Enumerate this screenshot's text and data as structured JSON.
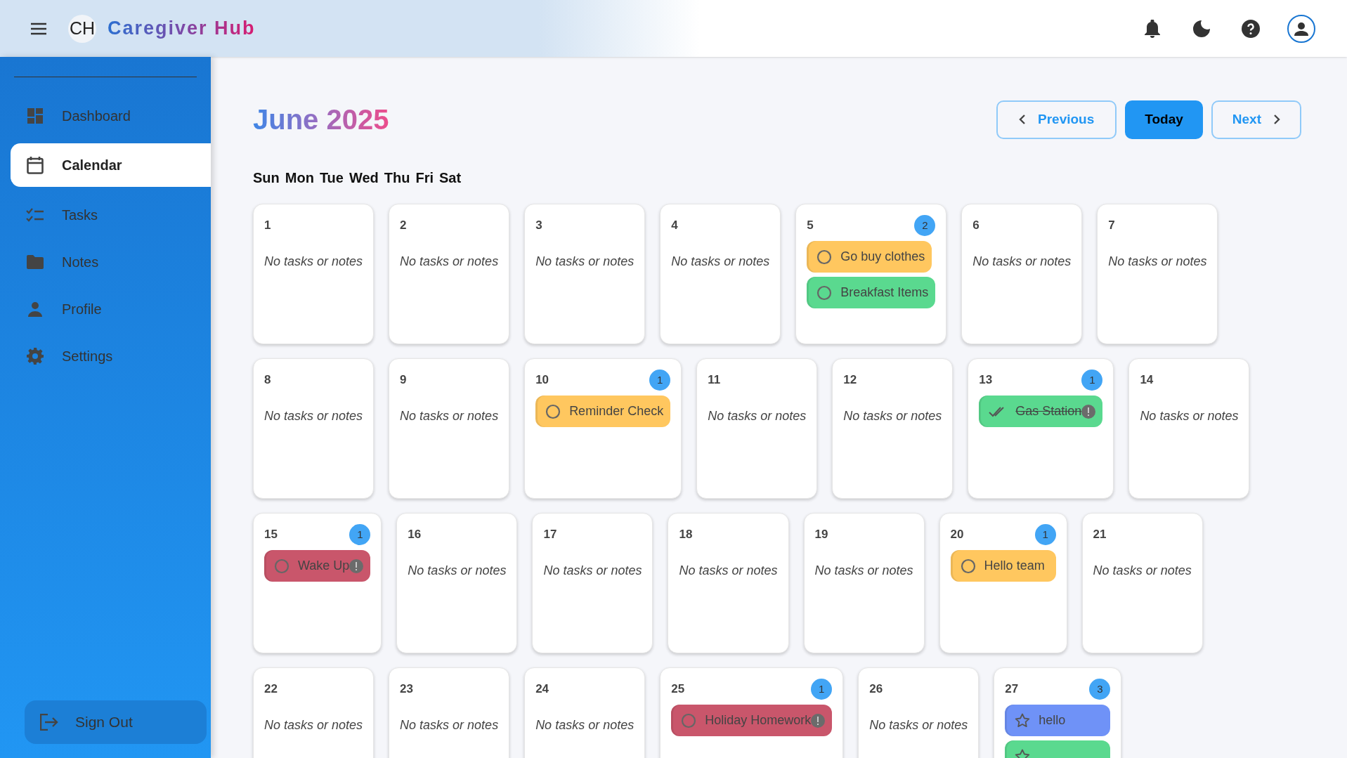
{
  "app": {
    "logo": "CH",
    "title_part1": "Caregiver",
    "title_part2": "Hub"
  },
  "sidebar": {
    "items": [
      {
        "label": "Dashboard",
        "kind": "dashboard",
        "selected": false
      },
      {
        "label": "Calendar",
        "kind": "calendar",
        "selected": true
      },
      {
        "label": "Tasks",
        "kind": "tasks",
        "selected": false
      },
      {
        "label": "Notes",
        "kind": "notes",
        "selected": false
      },
      {
        "label": "Profile",
        "kind": "profile",
        "selected": false
      },
      {
        "label": "Settings",
        "kind": "settings",
        "selected": false
      }
    ],
    "sign_out": "Sign Out"
  },
  "calendar": {
    "month": "June",
    "year": "2025",
    "buttons": {
      "previous": "Previous",
      "today": "Today",
      "next": "Next"
    },
    "weekdays": [
      "Sun",
      "Mon",
      "Tue",
      "Wed",
      "Thu",
      "Fri",
      "Sat"
    ],
    "weeks": [
      [
        {
          "day": "1",
          "empty_text": "No tasks or notes"
        },
        {
          "day": "2",
          "empty_text": "No tasks or notes"
        },
        {
          "day": "3",
          "empty_text": "No tasks or notes"
        },
        {
          "day": "4",
          "empty_text": "No tasks or notes"
        },
        {
          "day": "5",
          "count": "2",
          "items": [
            {
              "title": "Go buy clothes",
              "kind": "task",
              "done": false,
              "alert": false,
              "color": "#ffc75f"
            },
            {
              "title": "Breakfast Items",
              "kind": "task",
              "done": false,
              "alert": false,
              "color": "#5ad98f"
            }
          ]
        },
        {
          "day": "6",
          "empty_text": "No tasks or notes"
        },
        {
          "day": "7",
          "empty_text": "No tasks or notes"
        }
      ],
      [
        {
          "day": "8",
          "empty_text": "No tasks or notes"
        },
        {
          "day": "9",
          "empty_text": "No tasks or notes"
        },
        {
          "day": "10",
          "count": "1",
          "items": [
            {
              "title": "Reminder Check",
              "kind": "task",
              "done": false,
              "alert": false,
              "color": "#ffc75f"
            }
          ]
        },
        {
          "day": "11",
          "empty_text": "No tasks or notes"
        },
        {
          "day": "12",
          "empty_text": "No tasks or notes"
        },
        {
          "day": "13",
          "count": "1",
          "items": [
            {
              "title": "Gas Station",
              "kind": "task",
              "done": true,
              "alert": true,
              "color": "#5ad98f"
            }
          ]
        },
        {
          "day": "14",
          "empty_text": "No tasks or notes"
        }
      ],
      [
        {
          "day": "15",
          "count": "1",
          "items": [
            {
              "title": "Wake Up",
              "kind": "task",
              "done": false,
              "alert": true,
              "color": "#c9566b"
            }
          ]
        },
        {
          "day": "16",
          "empty_text": "No tasks or notes"
        },
        {
          "day": "17",
          "empty_text": "No tasks or notes"
        },
        {
          "day": "18",
          "empty_text": "No tasks or notes"
        },
        {
          "day": "19",
          "empty_text": "No tasks or notes"
        },
        {
          "day": "20",
          "count": "1",
          "items": [
            {
              "title": "Hello team",
              "kind": "task",
              "done": false,
              "alert": false,
              "color": "#ffc75f"
            }
          ]
        },
        {
          "day": "21",
          "empty_text": "No tasks or notes"
        }
      ],
      [
        {
          "day": "22",
          "empty_text": "No tasks or notes"
        },
        {
          "day": "23",
          "empty_text": "No tasks or notes"
        },
        {
          "day": "24",
          "empty_text": "No tasks or notes"
        },
        {
          "day": "25",
          "count": "1",
          "items": [
            {
              "title": "Holiday Homework",
              "kind": "task",
              "done": false,
              "alert": true,
              "color": "#c9566b"
            }
          ]
        },
        {
          "day": "26",
          "empty_text": "No tasks or notes"
        },
        {
          "day": "27",
          "count": "3",
          "items": [
            {
              "title": "hello",
              "kind": "note",
              "done": false,
              "alert": false,
              "color": "#6f92f7"
            },
            {
              "kind": "note",
              "done": false,
              "alert": false,
              "color": "#5ad98f"
            }
          ]
        }
      ]
    ]
  }
}
